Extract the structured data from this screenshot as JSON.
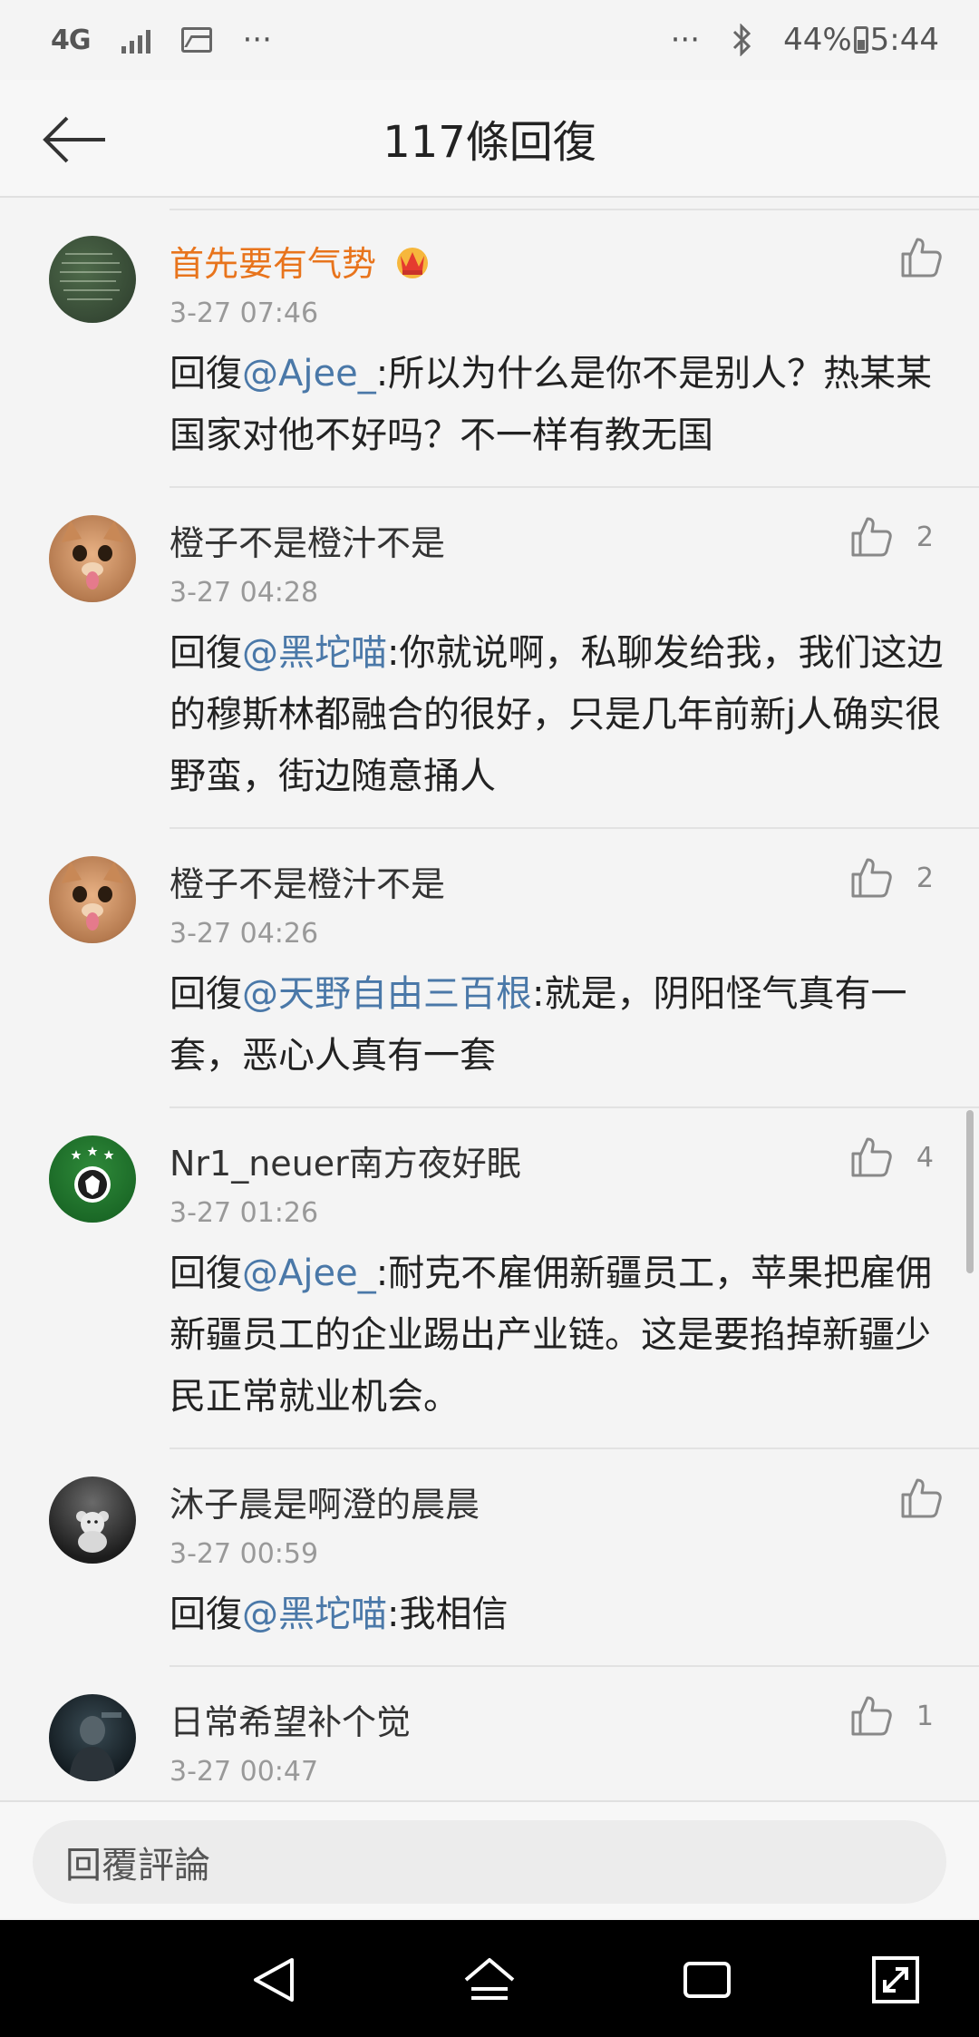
{
  "status_bar": {
    "network": "4G",
    "overflow_left": "···",
    "overflow_right": "···",
    "battery": "44%",
    "time": "5:44"
  },
  "header": {
    "title": "117條回復"
  },
  "comments": [
    {
      "name": "首先要有气势",
      "vip": true,
      "time": "3-27 07:46",
      "prefix": "回復",
      "mention": "@Ajee_",
      "text": ":所以为什么是你不是别人？热某某国家对他不好吗？不一样有教无国",
      "likes": ""
    },
    {
      "name": "橙子不是橙汁不是",
      "time": "3-27 04:28",
      "prefix": "回復",
      "mention": "@黑坨喵",
      "text": ":你就说啊，私聊发给我，我们这边的穆斯林都融合的很好，只是几年前新j人确实很野蛮，街边随意捅人",
      "likes": "2"
    },
    {
      "name": "橙子不是橙汁不是",
      "time": "3-27 04:26",
      "prefix": "回復",
      "mention": "@天野自由三百根",
      "text": ":就是，阴阳怪气真有一套，恶心人真有一套",
      "likes": "2"
    },
    {
      "name": "Nr1_neuer南方夜好眠",
      "time": "3-27 01:26",
      "prefix": "回復",
      "mention": "@Ajee_",
      "text": ":耐克不雇佣新疆员工，苹果把雇佣新疆员工的企业踢出产业链。这是要掐掉新疆少民正常就业机会。",
      "likes": "4"
    },
    {
      "name": "沐子晨是啊澄的晨晨",
      "time": "3-27 00:59",
      "prefix": "回復",
      "mention": "@黑坨喵",
      "text": ":我相信",
      "likes": ""
    },
    {
      "name": "日常希望补个觉",
      "time": "3-27 00:47",
      "prefix": "",
      "mention": "",
      "text": "",
      "likes": "1"
    }
  ],
  "reply_bar": {
    "placeholder": "回覆評論"
  },
  "icons": {
    "back": "arrow-left-icon",
    "like": "thumbs-up-icon",
    "crown": "crown-badge-icon"
  },
  "colors": {
    "mention": "#4a78a8",
    "vip_name": "#e8741c"
  }
}
